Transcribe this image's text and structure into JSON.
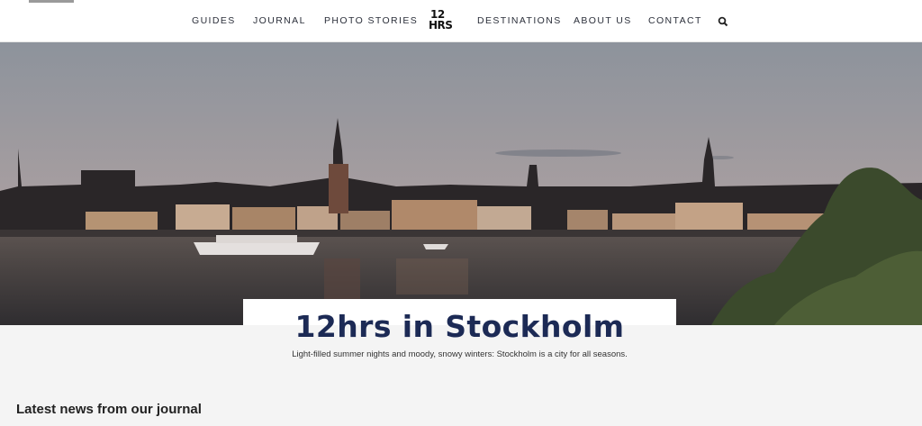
{
  "nav": {
    "items": [
      {
        "label": "GUIDES"
      },
      {
        "label": "JOURNAL"
      },
      {
        "label": "PHOTO STORIES"
      },
      {
        "label": "DESTINATIONS"
      },
      {
        "label": "ABOUT US"
      },
      {
        "label": "CONTACT"
      }
    ],
    "logo": {
      "line1": "12",
      "line2": "HRS"
    },
    "search_icon": "search-icon"
  },
  "hero": {
    "image": "stockholm-waterfront-photo",
    "title": "12hrs in Stockholm",
    "subtitle": "Light-filled summer nights and moody, snowy winters: Stockholm is a city for all seasons."
  },
  "journal": {
    "heading": "Latest news from our journal"
  },
  "colors": {
    "title_navy": "#1c2a55",
    "nav_text": "#2b2f3a",
    "page_bg": "#f4f4f4"
  }
}
